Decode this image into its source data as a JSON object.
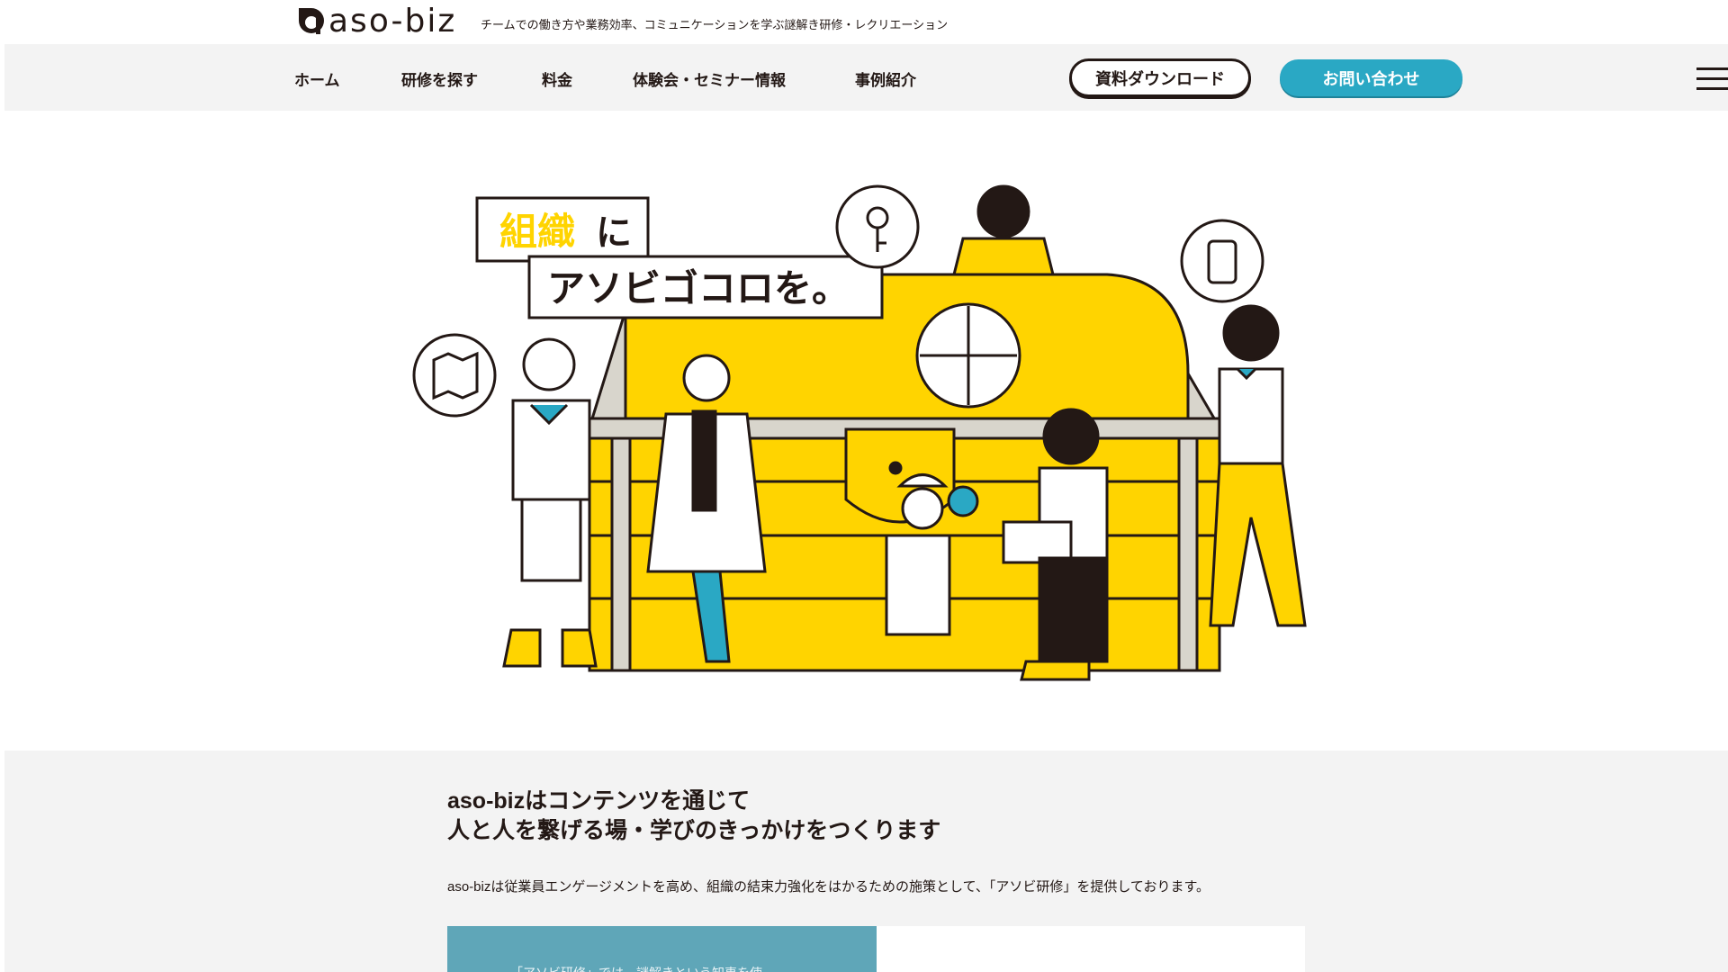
{
  "header": {
    "logo_text": "aso-biz",
    "tagline": "チームでの働き方や業務効率、コミュニケーションを学ぶ謎解き研修・レクリエーション"
  },
  "nav": {
    "items": [
      {
        "label": "ホーム"
      },
      {
        "label": "研修を探す"
      },
      {
        "label": "料金"
      },
      {
        "label": "体験会・セミナー情報"
      },
      {
        "label": "事例紹介"
      }
    ],
    "download_label": "資料ダウンロード",
    "contact_label": "お問い合わせ"
  },
  "hero": {
    "headline_accent": "組織",
    "headline_particle": "に",
    "headline_line2": "アソビゴコロを。"
  },
  "about": {
    "title_line1": "aso-bizはコンテンツを通じて",
    "title_line2": "人と人を繋げる場・学びのきっかけをつくります",
    "description": "aso-bizは従業員エンゲージメントを高め、組織の結束力強化をはかるための施策として、「アソビ研修」を提供しております。",
    "card_text": "「アソビ研修」では、謎解きという知恵を使"
  },
  "colors": {
    "accent_yellow": "#ffd400",
    "brand_teal": "#2aa8c4",
    "ink": "#231815",
    "section_gray": "#f3f3f3"
  },
  "icons": {
    "logo": "aso-biz-logo-icon",
    "menu": "hamburger-menu-icon",
    "key": "key-icon",
    "map": "map-icon",
    "phone": "smartphone-key-icon"
  }
}
